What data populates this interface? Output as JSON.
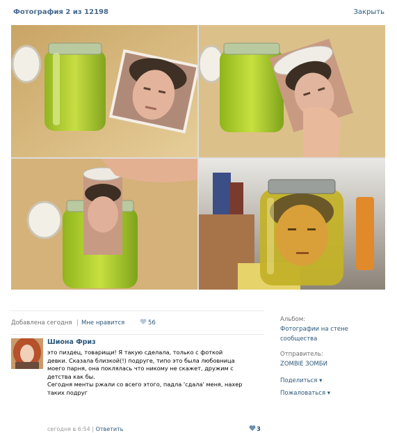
{
  "header": {
    "title": "Фотография 2 из 12198",
    "close_label": "Закрыть"
  },
  "photo": {
    "panels": [
      "jar-and-face-photo",
      "photo-rolled",
      "photo-inserted",
      "head-in-jar-fridge"
    ]
  },
  "meta": {
    "added": "Добавлена сегодня",
    "separator": "|",
    "like_label": "Мне нравится",
    "like_count": "56",
    "heart_color": "#b6c7d9"
  },
  "comment": {
    "author": "Шиона Фриз",
    "text": "это пиздец, товарищи! Я такую сделала, только с фоткой\nдевки. Сказала близкой(!) подруге, типо это была любовница\nмоего парня, она поклялась что никому не скажет, дружим с\nдетства как бы.\nСегодня менты ржали со всего этого, падла 'сдала' меня, нахер\nтаких подруг",
    "time": "сегодня в 6:54",
    "divider": "|",
    "reply_label": "Ответить",
    "like_count": "3"
  },
  "sidebar": {
    "album_label": "Альбом:",
    "album_value": "Фотографии на стене сообщества",
    "sender_label": "Отправитель:",
    "sender_value": "ZOMBIE ЗОМБИ",
    "share_label": "Поделиться ▾",
    "report_label": "Пожаловаться ▾"
  },
  "colors": {
    "link": "#2b587a",
    "title": "#45688e",
    "muted": "#6e6e6e"
  }
}
